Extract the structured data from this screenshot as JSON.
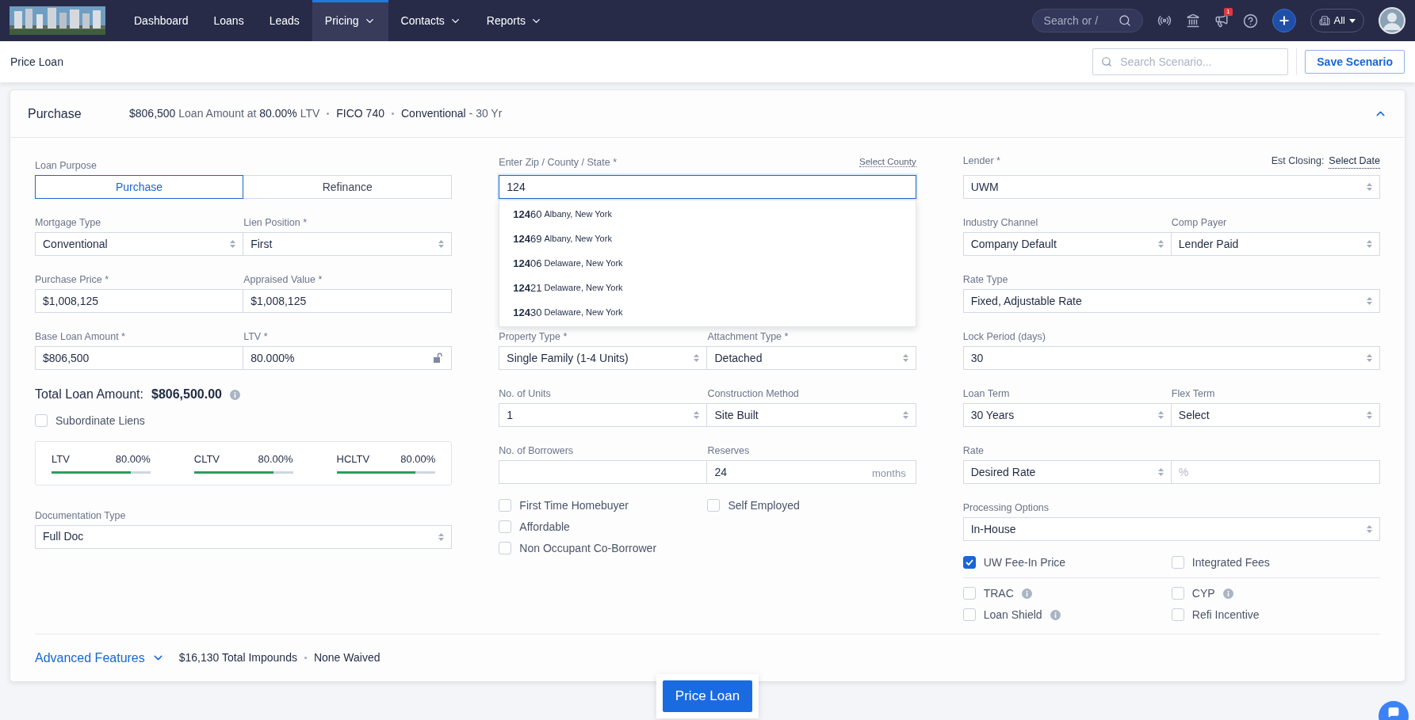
{
  "nav": {
    "items": [
      {
        "label": "Dashboard",
        "selected": false,
        "menu": false
      },
      {
        "label": "Loans",
        "selected": false,
        "menu": false
      },
      {
        "label": "Leads",
        "selected": false,
        "menu": false
      },
      {
        "label": "Pricing",
        "selected": true,
        "menu": true
      },
      {
        "label": "Contacts",
        "selected": false,
        "menu": true
      },
      {
        "label": "Reports",
        "selected": false,
        "menu": true
      }
    ],
    "search": {
      "placeholder": "Search or /"
    },
    "notification_count": "1",
    "filter": "All"
  },
  "page": {
    "title": "Price Loan",
    "search": {
      "placeholder": "Search Scenario..."
    },
    "save_button": "Save Scenario"
  },
  "scenario": {
    "title": "Purchase",
    "expanded": true,
    "summary": [
      "**$806,500** Loan Amount at **80.00%** LTV",
      "**FICO 740**",
      "**Conventional** - 30 Yr"
    ]
  },
  "left": {
    "loan_purpose": {
      "label": "Loan Purpose",
      "options": [
        {
          "label": "Purchase",
          "selected": true
        },
        {
          "label": "Refinance",
          "selected": false
        }
      ]
    },
    "rows": [
      [
        {
          "label": "Mortgage Type",
          "kind": "select",
          "value": "Conventional"
        },
        {
          "label": "Lien Position *",
          "kind": "select",
          "value": "First"
        }
      ],
      [
        {
          "label": "Purchase Price *",
          "kind": "text",
          "value": "$1,008,125"
        },
        {
          "label": "Appraised Value *",
          "kind": "text",
          "value": "$1,008,125"
        }
      ],
      [
        {
          "label": "Base Loan Amount *",
          "kind": "text",
          "value": "$806,500"
        },
        {
          "label": "LTV *",
          "kind": "text",
          "value": "80.000%",
          "locked": false
        }
      ]
    ],
    "total": {
      "label": "Total Loan Amount:",
      "value": "$806,500.00"
    },
    "subordinate": {
      "label": "Subordinate Liens",
      "checked": false
    },
    "ratios": [
      {
        "label": "LTV",
        "value": "80.00%",
        "level": 0.8
      },
      {
        "label": "CLTV",
        "value": "80.00%",
        "level": 0.8
      },
      {
        "label": "HCLTV",
        "value": "80.00%",
        "level": 0.8
      }
    ],
    "documentation": {
      "label": "Documentation Type",
      "kind": "select",
      "value": "Full Doc"
    }
  },
  "middle": {
    "zip": {
      "label": "Enter Zip / County / State *",
      "link": "Select County",
      "value": "124",
      "focused": true,
      "suggestions": [
        {
          "zip": "**124**60",
          "place": "Albany, New York"
        },
        {
          "zip": "**124**69",
          "place": "Albany, New York"
        },
        {
          "zip": "**124**06",
          "place": "Delaware, New York"
        },
        {
          "zip": "**124**21",
          "place": "Delaware, New York"
        },
        {
          "zip": "**124**30",
          "place": "Delaware, New York"
        }
      ]
    },
    "rows": [
      [
        {
          "label": "Property Type *",
          "kind": "select",
          "value": "Single Family (1-4 Units)"
        },
        {
          "label": "Attachment Type *",
          "kind": "select",
          "value": "Detached"
        }
      ],
      [
        {
          "label": "No. of Units",
          "kind": "select",
          "value": "1"
        },
        {
          "label": "Construction Method",
          "kind": "select",
          "value": "Site Built"
        }
      ],
      [
        {
          "label": "No. of Borrowers",
          "kind": "text"
        },
        {
          "label": "Reserves",
          "kind": "text",
          "value": "24",
          "suffix": "months"
        }
      ]
    ],
    "checkboxes": [
      [
        {
          "label": "First Time Homebuyer",
          "checked": false
        },
        {
          "label": "Self Employed",
          "checked": false
        }
      ],
      [
        {
          "label": "Affordable",
          "checked": false
        }
      ],
      [
        {
          "label": "Non Occupant Co-Borrower",
          "checked": false
        }
      ]
    ]
  },
  "right": {
    "lender": {
      "label": "Lender *",
      "kind": "select",
      "value": "UWM",
      "closing_label": "Est Closing:",
      "closing_link": "Select Date"
    },
    "rows": [
      [
        {
          "label": "Industry Channel",
          "kind": "select",
          "value": "Company Default"
        },
        {
          "label": "Comp Payer",
          "kind": "select",
          "value": "Lender Paid"
        }
      ],
      [
        {
          "label": "Rate Type",
          "kind": "select",
          "value": "Fixed, Adjustable Rate"
        }
      ],
      [
        {
          "label": "Lock Period (days)",
          "kind": "select",
          "value": "30"
        }
      ],
      [
        {
          "label": "Loan Term",
          "kind": "select",
          "value": "30 Years"
        },
        {
          "label": "Flex Term",
          "kind": "select",
          "value": "Select"
        }
      ],
      [
        {
          "label": "Rate",
          "kind": "select",
          "value": "Desired Rate"
        },
        {
          "kind": "text",
          "placeholder": "%"
        }
      ],
      [
        {
          "label": "Processing Options",
          "kind": "select",
          "value": "In-House"
        }
      ]
    ],
    "options": [
      [
        {
          "label": "UW Fee-In Price",
          "checked": true,
          "info": false
        },
        {
          "label": "Integrated Fees",
          "checked": false,
          "info": false
        }
      ]
    ],
    "more_options": [
      [
        {
          "label": "TRAC",
          "checked": false,
          "info": true
        },
        {
          "label": "CYP",
          "checked": false,
          "info": true
        }
      ],
      [
        {
          "label": "Loan Shield",
          "checked": false,
          "info": true
        },
        {
          "label": "Refi Incentive",
          "checked": false,
          "info": false
        }
      ]
    ]
  },
  "footer": {
    "advanced": "Advanced Features",
    "expanded": false,
    "impounds": "$16,130 Total Impounds",
    "waived": "None Waived"
  },
  "price_button": "Price Loan"
}
